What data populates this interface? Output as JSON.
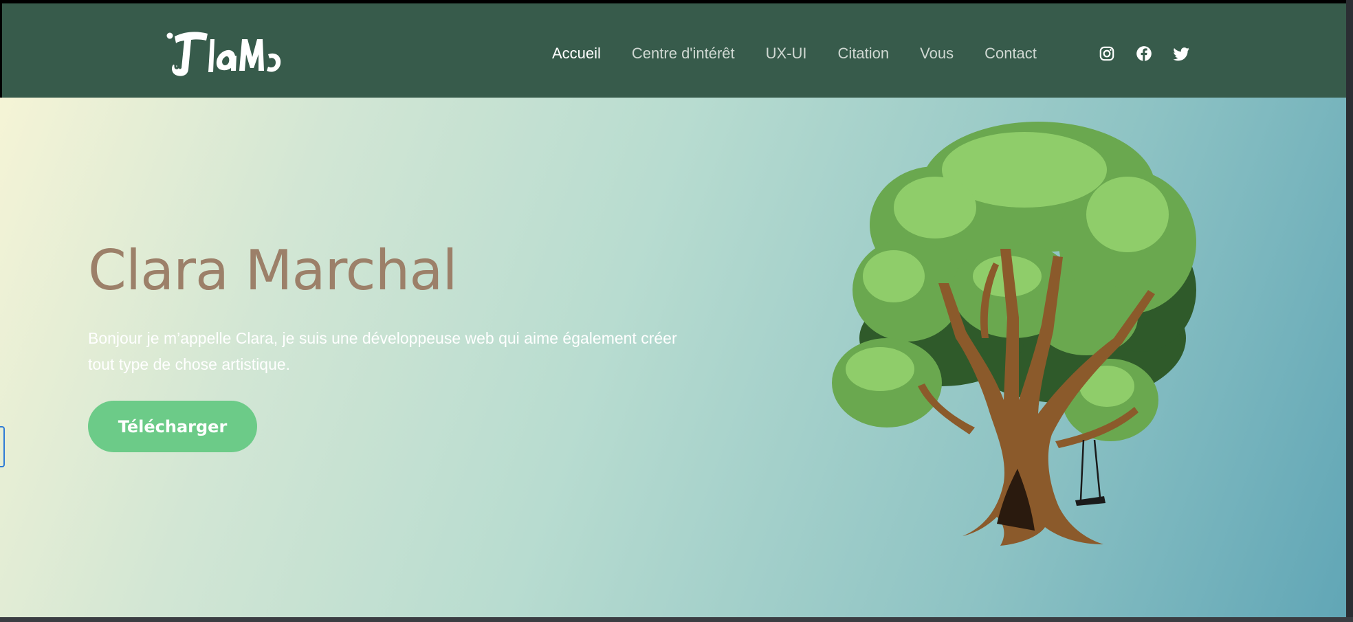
{
  "brand": {
    "logo_text": "ClaMa"
  },
  "nav": {
    "links": [
      {
        "label": "Accueil",
        "active": true
      },
      {
        "label": "Centre d'intérêt",
        "active": false
      },
      {
        "label": "UX-UI",
        "active": false
      },
      {
        "label": "Citation",
        "active": false
      },
      {
        "label": "Vous",
        "active": false
      },
      {
        "label": "Contact",
        "active": false
      }
    ],
    "social_icons": [
      "instagram-icon",
      "facebook-icon",
      "twitter-icon"
    ]
  },
  "hero": {
    "title": "Clara Marchal",
    "description": "Bonjour je m’appelle Clara, je suis une développeuse web qui aime également créer tout type de chose artistique.",
    "button_label": "Télécharger",
    "illustration": "tree-with-swing"
  },
  "colors": {
    "navbar_bg": "#375b4b",
    "title": "#9c8069",
    "button_bg": "#6ccb88",
    "gradient_start": "#f5f4d6",
    "gradient_end": "#61a6b6"
  }
}
